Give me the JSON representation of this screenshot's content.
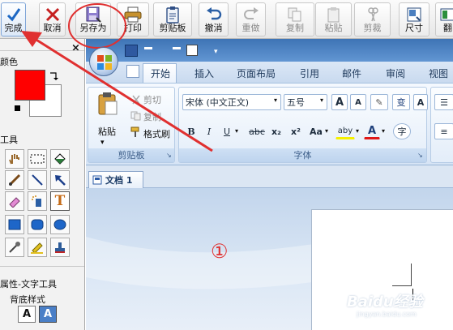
{
  "toolbar": {
    "buttons": [
      {
        "label": "完成",
        "icon": "checkmark-icon"
      },
      {
        "label": "取消",
        "icon": "cross-icon"
      },
      {
        "label": "另存为",
        "icon": "save-as-icon"
      },
      {
        "label": "打印",
        "icon": "printer-icon"
      },
      {
        "label": "剪贴板",
        "icon": "clipboard-icon"
      },
      {
        "label": "撤消",
        "icon": "undo-icon"
      },
      {
        "label": "重做",
        "icon": "redo-icon"
      },
      {
        "label": "复制",
        "icon": "copy-icon"
      },
      {
        "label": "粘贴",
        "icon": "paste-icon"
      },
      {
        "label": "剪裁",
        "icon": "crop-icon"
      },
      {
        "label": "尺寸",
        "icon": "resize-icon"
      },
      {
        "label": "翻",
        "icon": "flip-icon"
      }
    ]
  },
  "left_panel": {
    "color_label": "颜色",
    "primary_color": "#ff0000",
    "tools_label": "工具",
    "tools": [
      "hand",
      "rect-select",
      "fill",
      "brush",
      "line",
      "arrow",
      "eraser",
      "spray",
      "text",
      "rectangle",
      "rounded-rectangle",
      "ellipse",
      "eyedropper",
      "highlighter",
      "stamp"
    ],
    "props_label": "属性-文字工具",
    "bg_style_label": "背底样式",
    "bg_style_options": [
      "A",
      "A"
    ],
    "close_symbol": "×"
  },
  "word": {
    "ribbon_tabs": [
      "开始",
      "插入",
      "页面布局",
      "引用",
      "邮件",
      "审阅",
      "视图"
    ],
    "clipboard_group": {
      "title": "剪贴板",
      "paste": "粘贴",
      "cut": "剪切",
      "copy": "复制",
      "format_painter": "格式刷"
    },
    "font_group": {
      "title": "字体",
      "font_name": "宋体 (中文正文)",
      "font_size": "五号",
      "grow": "A",
      "shrink": "A",
      "phonetic": "变",
      "box": "A",
      "bold": "B",
      "italic": "I",
      "underline": "U",
      "strike": "abc",
      "subscript": "x₂",
      "superscript": "x²",
      "case": "Aa",
      "highlight": "aby",
      "font_color": "A",
      "enclose": "字"
    },
    "doc_tab": "文档 1",
    "annotation": "①"
  },
  "watermark": {
    "main": "Baidu经验",
    "sub": "jingyan.baidu.com"
  },
  "colors": {
    "annotation_red": "#e03030",
    "word_blue": "#1e395b",
    "accent": "#2b579a"
  }
}
